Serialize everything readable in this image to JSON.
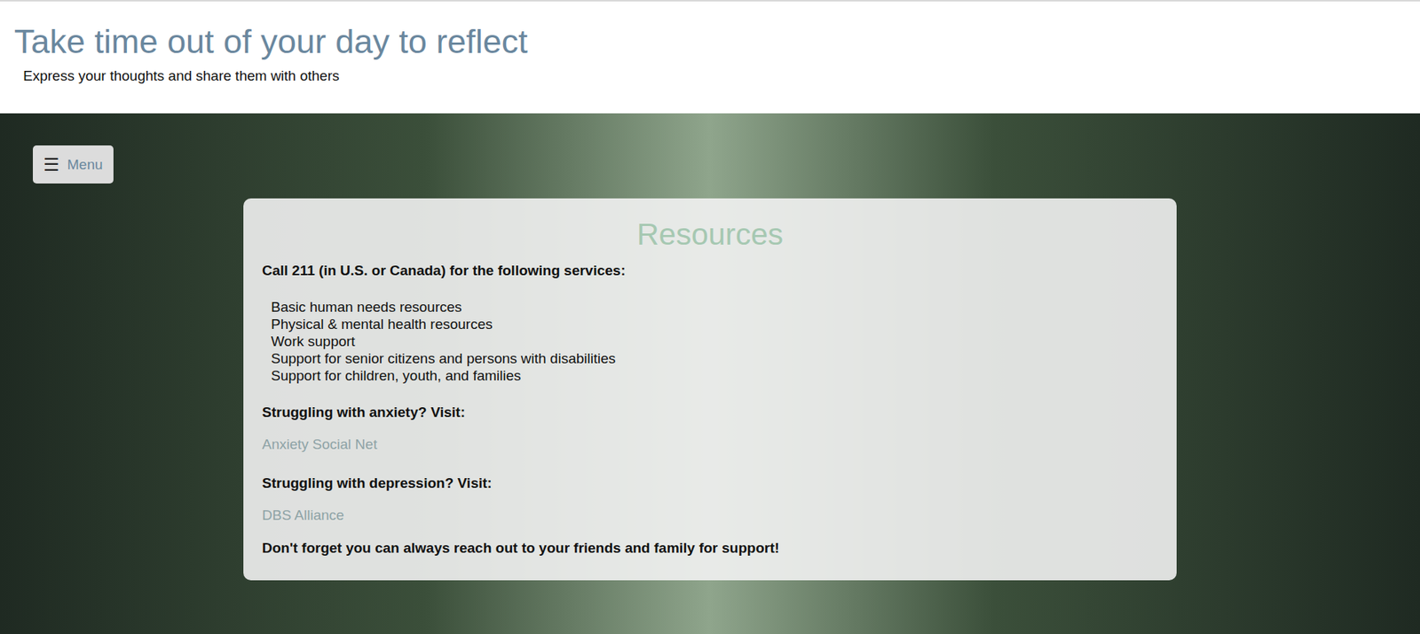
{
  "header": {
    "title": "Take time out of your day to reflect",
    "subtitle": "Express your thoughts and share them with others"
  },
  "menu_button": {
    "icon": "☰",
    "label": "Menu"
  },
  "resources": {
    "title": "Resources",
    "call_line": "Call 211 (in U.S. or Canada) for the following services:",
    "services": [
      "Basic human needs resources",
      "Physical & mental health resources",
      "Work support",
      "Support for senior citizens and persons with disabilities",
      "Support for children, youth, and families"
    ],
    "sections": [
      {
        "heading": "Struggling with anxiety? Visit:",
        "link": "Anxiety Social Net"
      },
      {
        "heading": "Struggling with depression? Visit:",
        "link": "DBS Alliance"
      }
    ],
    "closing": "Don't forget you can always reach out to your friends and family for support!"
  }
}
